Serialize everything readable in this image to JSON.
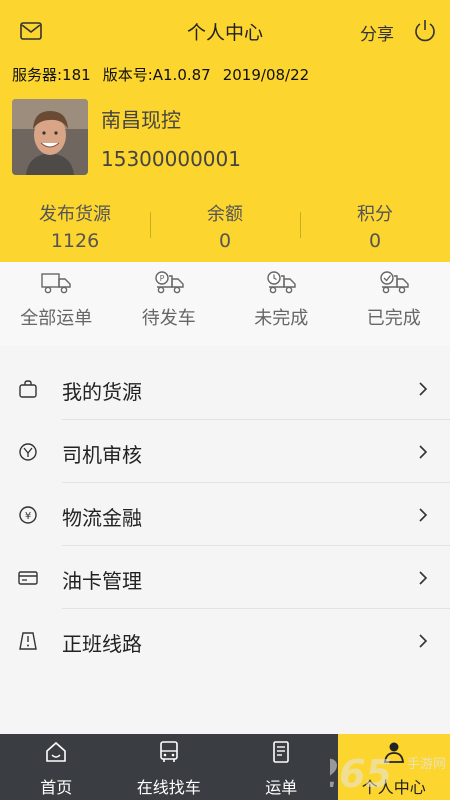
{
  "colors": {
    "brand": "#fcd52f",
    "tabbar_bg": "#3a3d42"
  },
  "header": {
    "title": "个人中心",
    "share_label": "分享",
    "mail_icon": "mail-icon",
    "power_icon": "power-icon",
    "server": "服务器:181",
    "version": "版本号:A1.0.87",
    "date": "2019/08/22"
  },
  "user": {
    "name": "南昌现控",
    "phone": "15300000001"
  },
  "stats": [
    {
      "label": "发布货源",
      "value": "1126"
    },
    {
      "label": "余额",
      "value": "0"
    },
    {
      "label": "积分",
      "value": "0"
    }
  ],
  "orders": [
    {
      "label": "全部运单",
      "icon": "truck-icon"
    },
    {
      "label": "待发车",
      "icon": "truck-pending-icon"
    },
    {
      "label": "未完成",
      "icon": "truck-clock-icon"
    },
    {
      "label": "已完成",
      "icon": "truck-check-icon"
    }
  ],
  "menu": [
    {
      "label": "我的货源",
      "icon": "bag-icon"
    },
    {
      "label": "司机审核",
      "icon": "review-icon"
    },
    {
      "label": "物流金融",
      "icon": "yuan-icon"
    },
    {
      "label": "油卡管理",
      "icon": "card-icon"
    },
    {
      "label": "正班线路",
      "icon": "route-icon"
    }
  ],
  "tabs": [
    {
      "label": "首页",
      "icon": "home-icon",
      "active": false
    },
    {
      "label": "在线找车",
      "icon": "bus-icon",
      "active": false
    },
    {
      "label": "运单",
      "icon": "document-icon",
      "active": false
    },
    {
      "label": "个人中心",
      "icon": "person-icon",
      "active": true
    }
  ],
  "watermark": {
    "number": "2265",
    "text": "手游网"
  }
}
